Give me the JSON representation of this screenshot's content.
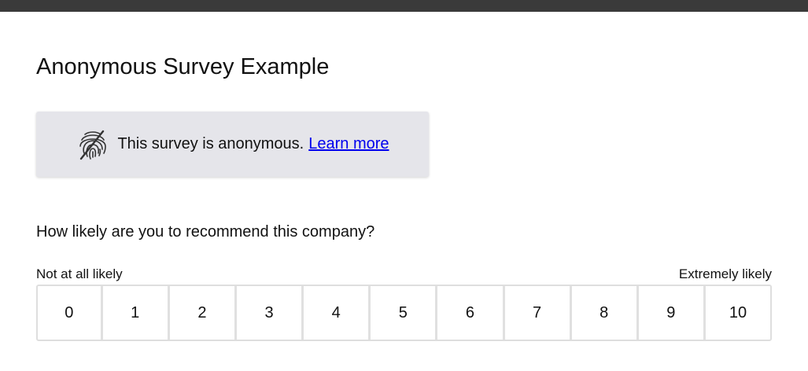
{
  "page": {
    "title": "Anonymous Survey Example",
    "top_bar_color": "#3a3a3a"
  },
  "notice": {
    "icon": "fingerprint-slash-icon",
    "text": "This survey is anonymous.",
    "link_label": "Learn more",
    "background_color": "#e5e5ea",
    "link_color": "#0000ee"
  },
  "question": {
    "text": "How likely are you to recommend this company?",
    "min_label": "Not at all likely",
    "max_label": "Extremely likely",
    "options": [
      "0",
      "1",
      "2",
      "3",
      "4",
      "5",
      "6",
      "7",
      "8",
      "9",
      "10"
    ]
  }
}
